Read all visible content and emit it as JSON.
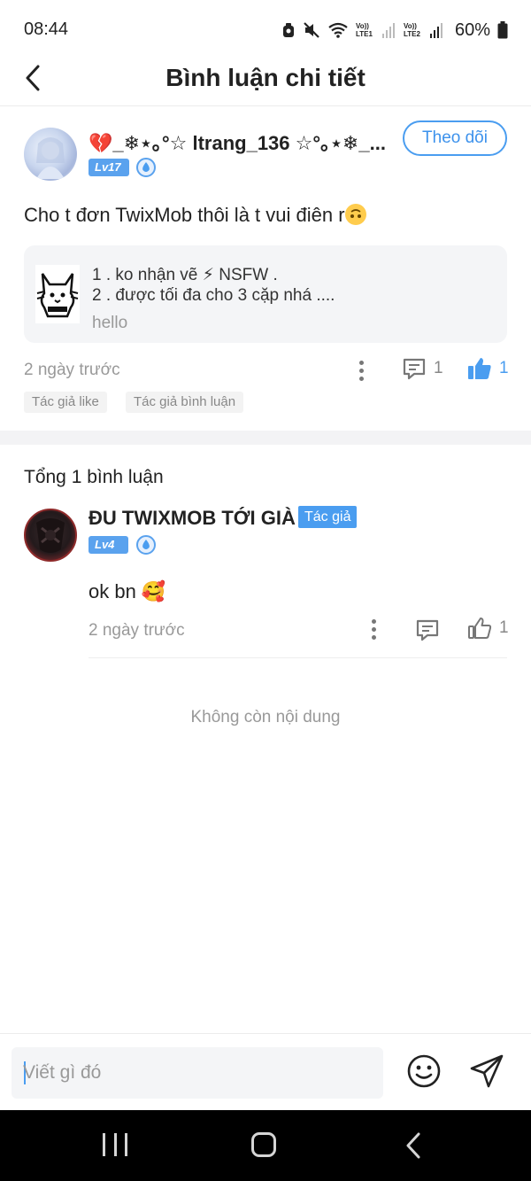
{
  "status_bar": {
    "time": "08:44",
    "battery": "60%",
    "sim1_label": "Vo)) LTE1",
    "sim2_label": "Vo)) LTE2"
  },
  "header": {
    "title": "Bình luận chi tiết"
  },
  "post": {
    "username": "💔_❄⋆｡°☆ ltrang_136 ☆°｡⋆❄_...",
    "level": "Lv17",
    "follow_label": "Theo dõi",
    "text": "Cho t đơn TwixMob thôi là t vui điên r",
    "linked_card": {
      "line1": "1 . ko nhận vẽ ⚡ NSFW .",
      "line2": "2 . được tối đa cho 3 cặp nhá ....",
      "subtitle": "hello"
    },
    "time": "2 ngày trước",
    "comment_count": "1",
    "like_count": "1",
    "tags": [
      "Tác giả like",
      "Tác giả bình luận"
    ]
  },
  "comments": {
    "total_label": "Tổng 1 bình luận",
    "items": [
      {
        "username": "ĐU TWIXMOB TỚI GIÀ",
        "author_badge": "Tác giả",
        "level": "Lv4",
        "text": "ok bn 🥰",
        "time": "2 ngày trước",
        "like_count": "1"
      }
    ]
  },
  "end_message": "Không còn nội dung",
  "input": {
    "placeholder": "Viết gì đó"
  },
  "colors": {
    "accent": "#4a9df0",
    "text": "#222222",
    "muted": "#999999"
  }
}
